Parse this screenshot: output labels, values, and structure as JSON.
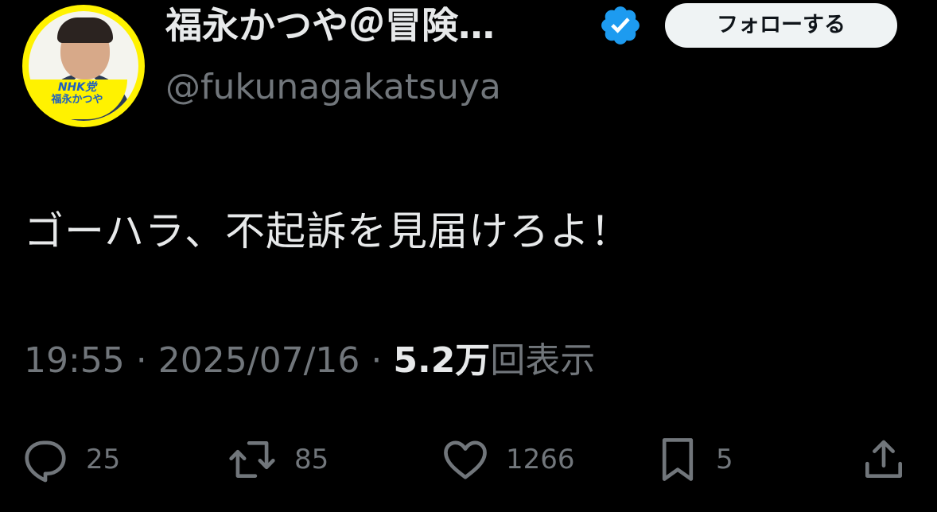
{
  "author": {
    "display_name": "福永かつや＠冒険…",
    "handle": "@fukunagakatsuya",
    "avatar_badge_line1": "NHK党",
    "avatar_badge_line2": "福永かつや",
    "verified": true
  },
  "follow_button_label": "フォローする",
  "tweet": {
    "text": "ゴーハラ、不起訴を見届けろよ！",
    "time": "19:55",
    "separator": " · ",
    "date": "2025/07/16",
    "views_count": "5.2万",
    "views_label": "回表示"
  },
  "actions": {
    "reply": {
      "icon": "reply-icon",
      "count": "25"
    },
    "retweet": {
      "icon": "retweet-icon",
      "count": "85"
    },
    "like": {
      "icon": "heart-icon",
      "count": "1266"
    },
    "bookmark": {
      "icon": "bookmark-icon",
      "count": "5"
    },
    "share": {
      "icon": "share-icon"
    }
  },
  "colors": {
    "background": "#000000",
    "primary_text": "#e7e9ea",
    "secondary_text": "#71767b",
    "verified_badge": "#1d9bf0",
    "follow_button_bg": "#eff3f4",
    "avatar_ring": "#fff200"
  }
}
